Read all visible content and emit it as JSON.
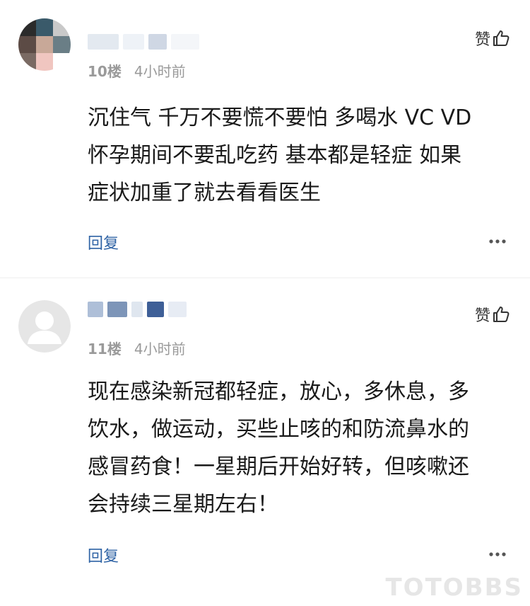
{
  "comments": [
    {
      "floor": "10楼",
      "time": "4小时前",
      "like_label": "赞",
      "lines": [
        "沉住气 千万不要慌不要怕 多喝水 VC VD",
        "怀孕期间不要乱吃药 基本都是轻症 如果",
        "症状加重了就去看看医生"
      ],
      "reply_label": "回复",
      "avatar_style": "pixelated",
      "avatar_colors": [
        "#2b2b2b",
        "#3a5a6a",
        "#c9c9c9",
        "#5c4b45",
        "#c8a898",
        "#6a7e86",
        "#7a6a63",
        "#f0c6c0",
        "#ffffff"
      ],
      "name_blur_colors": [
        "#e3e9f0",
        "#eef2f7",
        "#cfd7e4",
        "#f4f6f9"
      ]
    },
    {
      "floor": "11楼",
      "time": "4小时前",
      "like_label": "赞",
      "lines": [
        "现在感染新冠都轻症，放心，多休息，多",
        "饮水，做运动，买些止咳的和防流鼻水的",
        "感冒药食！一星期后开始好转，但咳嗽还",
        "会持续三星期左右！"
      ],
      "reply_label": "回复",
      "avatar_style": "default",
      "name_blur_colors": [
        "#aebfd8",
        "#7d95b8",
        "#dfe6ef",
        "#3e5f97",
        "#e7ecf4"
      ]
    }
  ],
  "watermark": "TOTOBBS",
  "colors": {
    "reply": "#2f63a5",
    "meta": "#9a9a9a",
    "text": "#1a1a1a"
  }
}
